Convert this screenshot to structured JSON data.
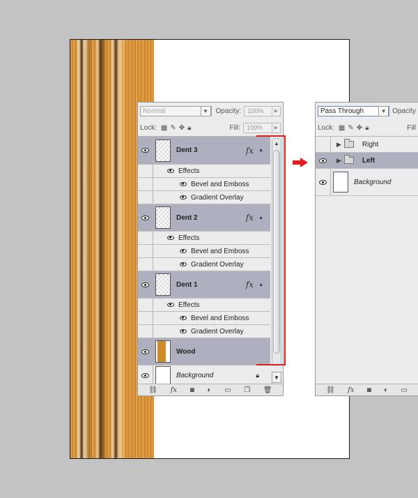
{
  "panel_left": {
    "blend_mode": "Normal",
    "opacity_label": "Opacity:",
    "opacity_value": "100%",
    "lock_label": "Lock:",
    "fill_label": "Fill:",
    "fill_value": "100%",
    "layers": [
      {
        "name": "Dent 3",
        "effects_label": "Effects",
        "effects": [
          "Bevel and Emboss",
          "Gradient Overlay"
        ],
        "fx": "fx"
      },
      {
        "name": "Dent 2",
        "effects_label": "Effects",
        "effects": [
          "Bevel and Emboss",
          "Gradient Overlay"
        ],
        "fx": "fx"
      },
      {
        "name": "Dent 1",
        "effects_label": "Effects",
        "effects": [
          "Bevel and Emboss",
          "Gradient Overlay"
        ],
        "fx": "fx"
      },
      {
        "name": "Wood"
      },
      {
        "name": "Background"
      }
    ]
  },
  "panel_right": {
    "blend_mode": "Pass Through",
    "opacity_label": "Opacity",
    "lock_label": "Lock:",
    "fill_label": "Fill",
    "layers": [
      {
        "name": "Right"
      },
      {
        "name": "Left"
      },
      {
        "name": "Background"
      }
    ]
  },
  "colors": {
    "selected_row": "#afb0bf",
    "highlight": "#e01b1b",
    "wood": "#d99433"
  },
  "icons": [
    "eye-icon",
    "link-icon",
    "fx-icon",
    "mask-icon",
    "adjustment-icon",
    "folder-icon",
    "new-layer-icon",
    "trash-icon",
    "lock-icon",
    "brush-icon",
    "move-icon",
    "checker-icon"
  ]
}
